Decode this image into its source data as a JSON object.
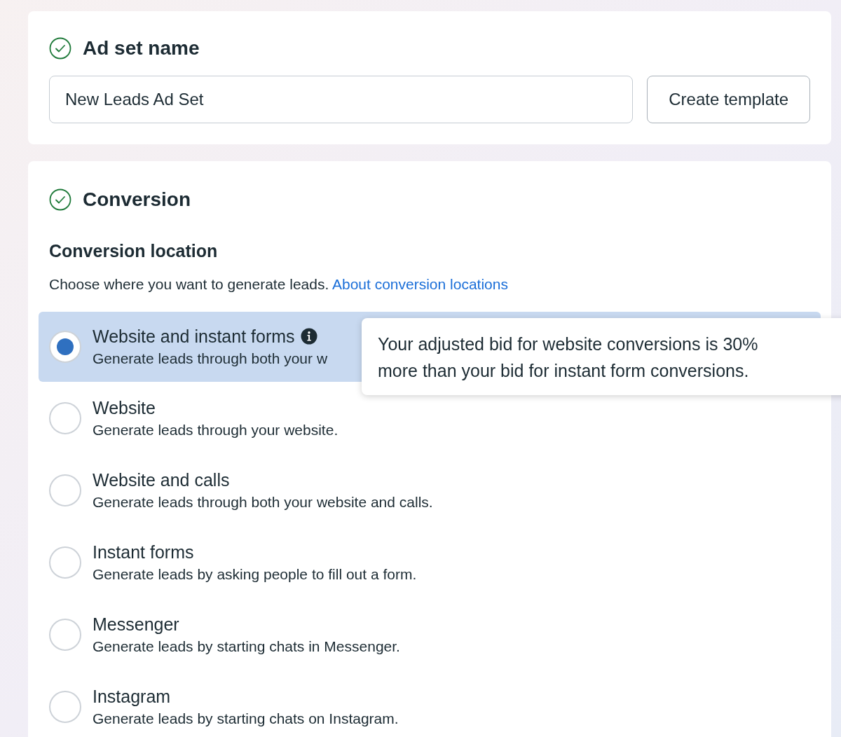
{
  "name_section": {
    "title": "Ad set name",
    "complete": true,
    "name_field": {
      "value": "New Leads Ad Set"
    },
    "template_button": "Create template"
  },
  "conversion_section": {
    "title": "Conversion",
    "complete": true,
    "location_heading": "Conversion location",
    "description": "Choose where you want to generate leads.",
    "link": "About conversion locations",
    "options": [
      {
        "title": "Website and instant forms",
        "description": "Generate leads through both your w",
        "selected": true,
        "info": true
      },
      {
        "title": "Website",
        "description": "Generate leads through your website.",
        "selected": false,
        "info": false
      },
      {
        "title": "Website and calls",
        "description": "Generate leads through both your website and calls.",
        "selected": false,
        "info": false
      },
      {
        "title": "Instant forms",
        "description": "Generate leads by asking people to fill out a form.",
        "selected": false,
        "info": false
      },
      {
        "title": "Messenger",
        "description": "Generate leads by starting chats in Messenger.",
        "selected": false,
        "info": false
      },
      {
        "title": "Instagram",
        "description": "Generate leads by starting chats on Instagram.",
        "selected": false,
        "info": false
      }
    ]
  },
  "tooltip": {
    "lines": [
      "Your adjusted bid for website conversions is 30%",
      "more than your bid for instant form conversions."
    ]
  }
}
